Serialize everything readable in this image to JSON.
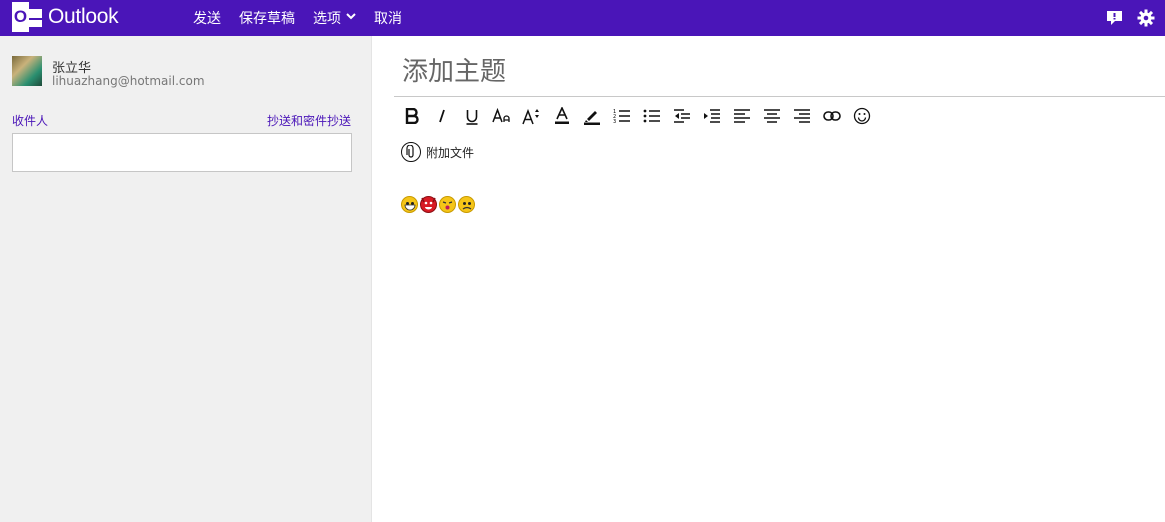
{
  "app": {
    "name": "Outlook",
    "logo_letter": "O"
  },
  "menu": {
    "send": "发送",
    "save_draft": "保存草稿",
    "options": "选项",
    "cancel": "取消"
  },
  "top_icons": [
    "feedback-icon",
    "gear-icon"
  ],
  "user": {
    "name": "张立华",
    "email": "lihuazhang@hotmail.com"
  },
  "recipients": {
    "to_label": "收件人",
    "cc_bcc_label": "抄送和密件抄送",
    "to_value": ""
  },
  "subject": {
    "placeholder": "添加主题",
    "value": ""
  },
  "toolbar": {
    "items": [
      "bold",
      "italic",
      "underline",
      "font-size",
      "grow-font",
      "font-color",
      "highlight",
      "numbered-list",
      "bulleted-list",
      "decrease-indent",
      "increase-indent",
      "align-left",
      "align-center",
      "align-right",
      "insert-link",
      "emoticons"
    ]
  },
  "attach": {
    "label": "附加文件"
  },
  "body": {
    "emoticons": [
      "grin",
      "devil",
      "kiss",
      "worried"
    ]
  },
  "colors": {
    "brand": "#4a15b8",
    "left_panel": "#f0f0f0",
    "link": "#4a15b8"
  }
}
